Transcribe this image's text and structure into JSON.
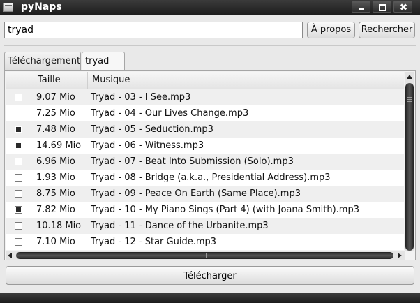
{
  "window": {
    "title": "pyNaps"
  },
  "search": {
    "value": "tryad"
  },
  "toolbar": {
    "about_label": "À propos",
    "search_label": "Rechercher"
  },
  "tabs": [
    {
      "label": "Téléchargement",
      "active": false
    },
    {
      "label": "tryad",
      "active": true,
      "icon": "badge-icon"
    }
  ],
  "table": {
    "headers": {
      "check": "",
      "size": "Taille",
      "music": "Musique"
    },
    "rows": [
      {
        "checked": false,
        "size": "9.07 Mio",
        "name": "Tryad - 03 - I See.mp3"
      },
      {
        "checked": false,
        "size": "7.25 Mio",
        "name": "Tryad - 04 - Our Lives Change.mp3"
      },
      {
        "checked": true,
        "size": "7.48 Mio",
        "name": "Tryad - 05 - Seduction.mp3"
      },
      {
        "checked": true,
        "size": "14.69 Mio",
        "name": "Tryad - 06 - Witness.mp3"
      },
      {
        "checked": false,
        "size": "6.96 Mio",
        "name": "Tryad - 07 - Beat Into Submission (Solo).mp3"
      },
      {
        "checked": false,
        "size": "1.93 Mio",
        "name": "Tryad - 08 - Bridge (a.k.a., Presidential Address).mp3"
      },
      {
        "checked": false,
        "size": "8.75 Mio",
        "name": "Tryad - 09 - Peace On Earth (Same Place).mp3"
      },
      {
        "checked": true,
        "size": "7.82 Mio",
        "name": "Tryad - 10 - My Piano Sings (Part 4) (with Joana Smith).mp3"
      },
      {
        "checked": false,
        "size": "10.18 Mio",
        "name": "Tryad - 11 - Dance of the Urbanite.mp3"
      },
      {
        "checked": false,
        "size": "7.10 Mio",
        "name": "Tryad - 12 - Star Guide.mp3"
      }
    ]
  },
  "footer": {
    "download_label": "Télécharger"
  }
}
